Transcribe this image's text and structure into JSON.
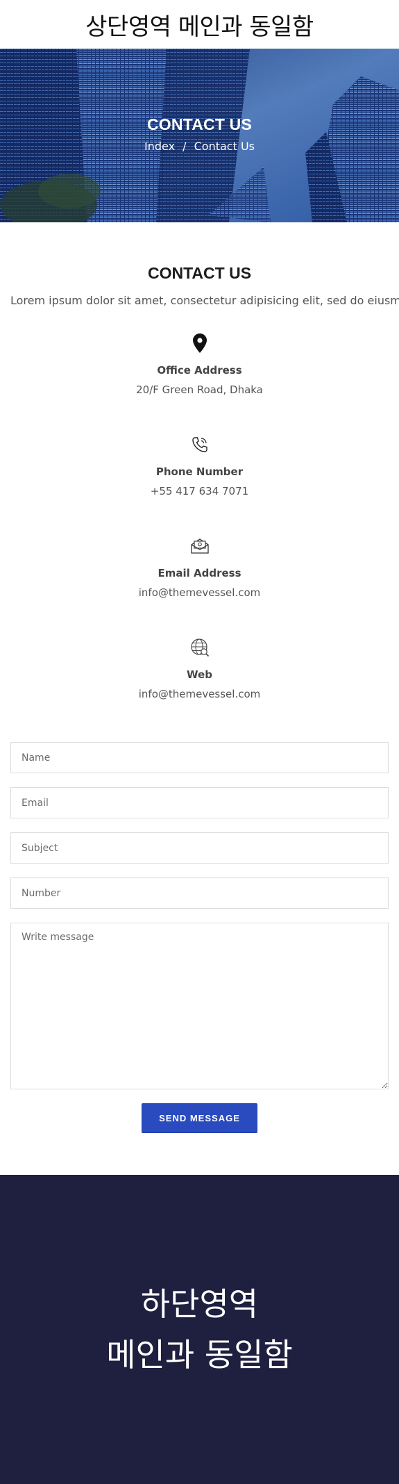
{
  "header": {
    "title": "상단영역 메인과 동일함"
  },
  "hero": {
    "title": "CONTACT US",
    "breadcrumb": {
      "home": "Index",
      "separator": "/",
      "current": "Contact Us"
    }
  },
  "contact": {
    "title": "CONTACT US",
    "subtitle": "Lorem ipsum dolor sit amet, consectetur adipisicing elit, sed do eiusmod",
    "items": [
      {
        "icon": "location-pin-icon",
        "label": "Office Address",
        "value": "20/F Green Road, Dhaka"
      },
      {
        "icon": "phone-icon",
        "label": "Phone Number",
        "value": "+55 417 634 7071"
      },
      {
        "icon": "envelope-icon",
        "label": "Email Address",
        "value": "info@themevessel.com"
      },
      {
        "icon": "globe-icon",
        "label": "Web",
        "value": "info@themevessel.com"
      }
    ]
  },
  "form": {
    "name_placeholder": "Name",
    "email_placeholder": "Email",
    "subject_placeholder": "Subject",
    "number_placeholder": "Number",
    "message_placeholder": "Write message",
    "submit_label": "SEND MESSAGE"
  },
  "footer": {
    "line1": "하단영역",
    "line2": "메인과 동일함"
  },
  "colors": {
    "accent": "#2a4bbf",
    "footer_bg": "#1f1f3f"
  }
}
